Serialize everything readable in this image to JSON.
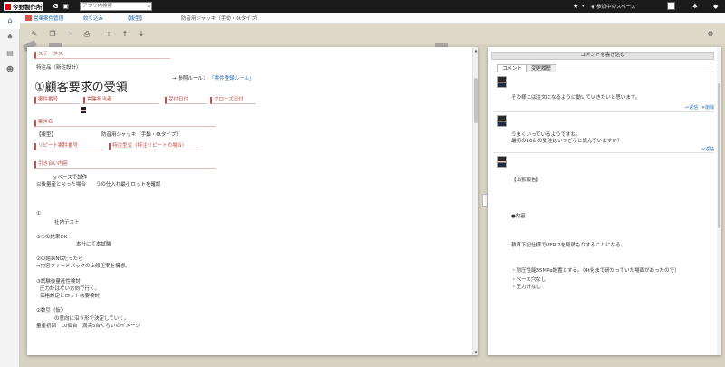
{
  "topbar": {
    "logo_text": "今野製作所",
    "g_icon": "G",
    "search_placeholder": "アプリ内検索",
    "space_link": "参加中のスペース",
    "star": "★",
    "notify": "◆"
  },
  "breadcrumb": {
    "items": [
      "営業案件管理",
      "絞り込み",
      "【複型】",
      "防音用ジャッキ（手動・6tタイプ）"
    ]
  },
  "paper": {
    "status_label": "ステータス",
    "category": "特注品（新注設計）",
    "title": "①顧客要求の受領",
    "ref_rule_label": "参照ルール：",
    "ref_rule_link": "「案件登録ルール」",
    "fields": {
      "case_no": "案件番号",
      "sales_owner": "営業担当者",
      "received_date": "受付日付",
      "close_date": "クローズ日付",
      "case_name": "案件名",
      "repeat_no": "リピート案件番号",
      "repeat_type": "特注型式（特注リピートの場合）",
      "handover": "引き合い内容"
    },
    "case_tag": "【複型】",
    "case_name_value": "防音用ジャッキ（手動・6tタイプ）",
    "body_lines": [
      "ｙベースで試作",
      "以後量産となった場合　　うの仕入れ最小ロットを確認",
      "①",
      "社内テスト",
      "②①の結果OK",
      "本社にて本試験",
      "②の結果NGだったら",
      "⇒内容フィードバックの上修正案を構想。",
      "③試験後量産性検討",
      "圧力計はない方向で行く。",
      "価格設定とロットは要検討",
      "②数引（仮）",
      "の意向に沿う形で決定していく。",
      "量産初回　10個台　満完5台くらいのイメージ"
    ]
  },
  "comments": {
    "write_button": "コメントを書き込む",
    "tabs": [
      "コメント",
      "変更履歴"
    ],
    "entries": [
      {
        "text": "その様には注文になるように動いていきたいと思います。",
        "actions": [
          "返信",
          "削除"
        ]
      },
      {
        "lines": [
          "うまくいっているようですね。",
          "最初の10台の受注はいつごろと読んでいますか？"
        ],
        "actions": [
          "返信"
        ]
      },
      {
        "lines": [
          "【出張報告】",
          "●内容",
          "積算下記仕様でVER.2を見積もりすることになる。",
          "・耐圧性能35MPa設置とする。（4t化まで研かっていた場面があったので）",
          "・ベース穴なし",
          "・圧力計なし"
        ]
      }
    ]
  }
}
